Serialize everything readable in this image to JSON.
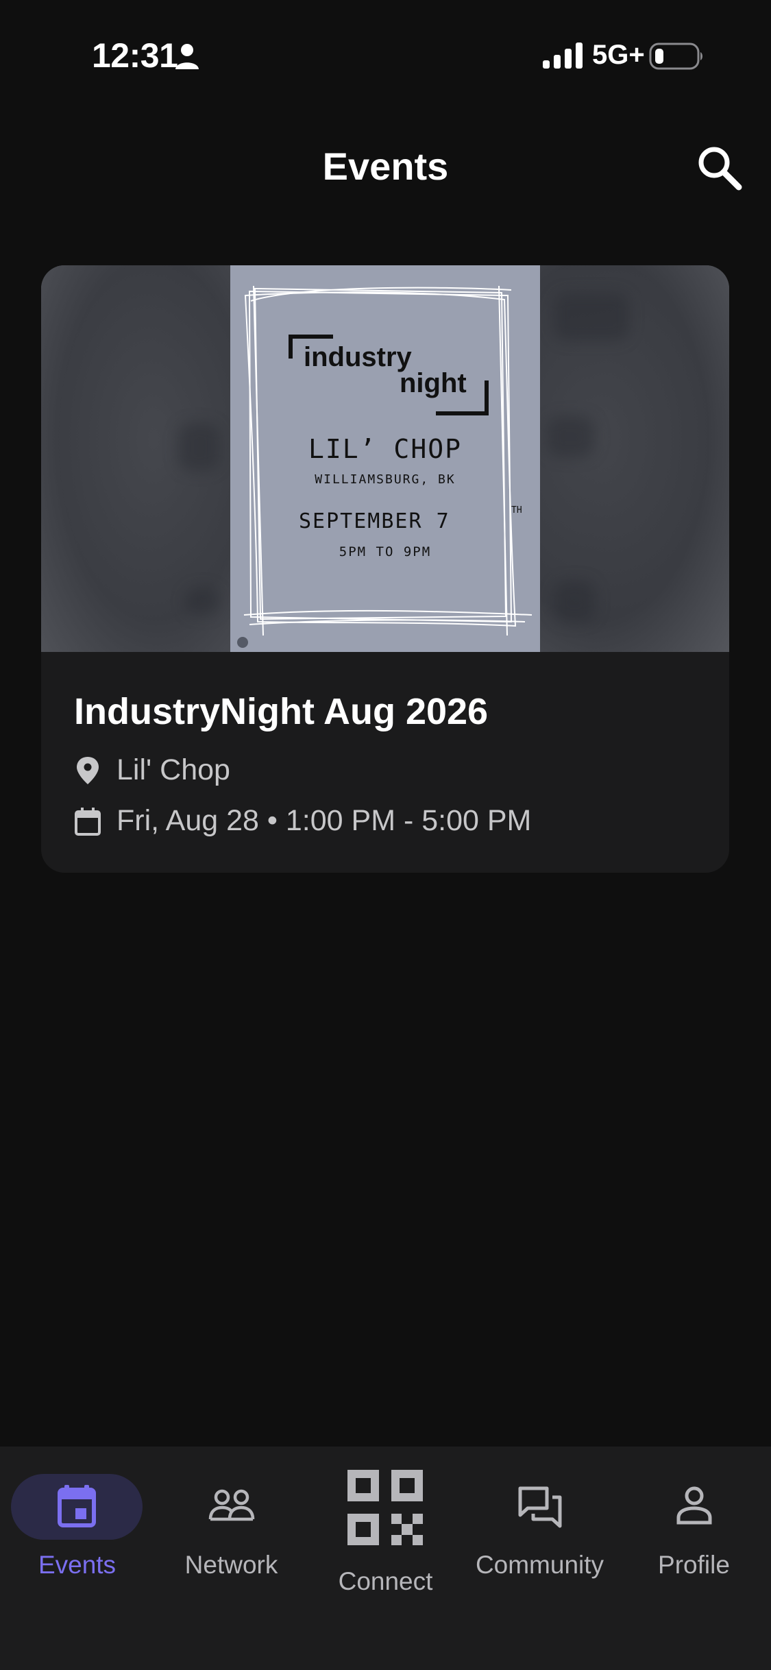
{
  "status_bar": {
    "time": "12:31",
    "network": "5G+"
  },
  "header": {
    "title": "Events"
  },
  "events": [
    {
      "title": "IndustryNight Aug 2026",
      "venue": "Lil' Chop",
      "datetime": "Fri, Aug 28 • 1:00 PM - 5:00 PM",
      "poster": {
        "brand_line1": "industry",
        "brand_line2": "night",
        "venue": "LIL’ CHOP",
        "area": "WILLIAMSBURG, BK",
        "date": "SEPTEMBER 7",
        "date_suffix": "TH",
        "time": "5PM TO 9PM"
      }
    }
  ],
  "bottom_nav": {
    "items": [
      {
        "label": "Events",
        "icon": "calendar-icon",
        "active": true
      },
      {
        "label": "Network",
        "icon": "people-icon",
        "active": false
      },
      {
        "label": "Connect",
        "icon": "qr-code-icon",
        "active": false
      },
      {
        "label": "Community",
        "icon": "chat-bubbles-icon",
        "active": false
      },
      {
        "label": "Profile",
        "icon": "person-icon",
        "active": false
      }
    ]
  },
  "colors": {
    "background": "#0f0f0f",
    "card": "#1b1b1c",
    "nav_background": "#1c1c1d",
    "accent": "#7b6ff0",
    "active_pill": "#2b2a47"
  }
}
